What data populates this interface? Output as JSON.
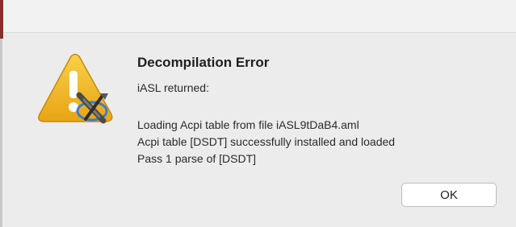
{
  "dialog": {
    "title": "Decompilation Error",
    "subtitle": "iASL returned:",
    "log_lines": [
      "Loading Acpi table from file iASL9tDaB4.aml",
      "Acpi table [DSDT] successfully installed and loaded",
      "Pass 1 parse of [DSDT]"
    ],
    "ok_label": "OK",
    "icon": "warning-triangle-with-tools-icon"
  },
  "colors": {
    "warning_yellow": "#f2b51c",
    "window_background": "#ececec"
  }
}
